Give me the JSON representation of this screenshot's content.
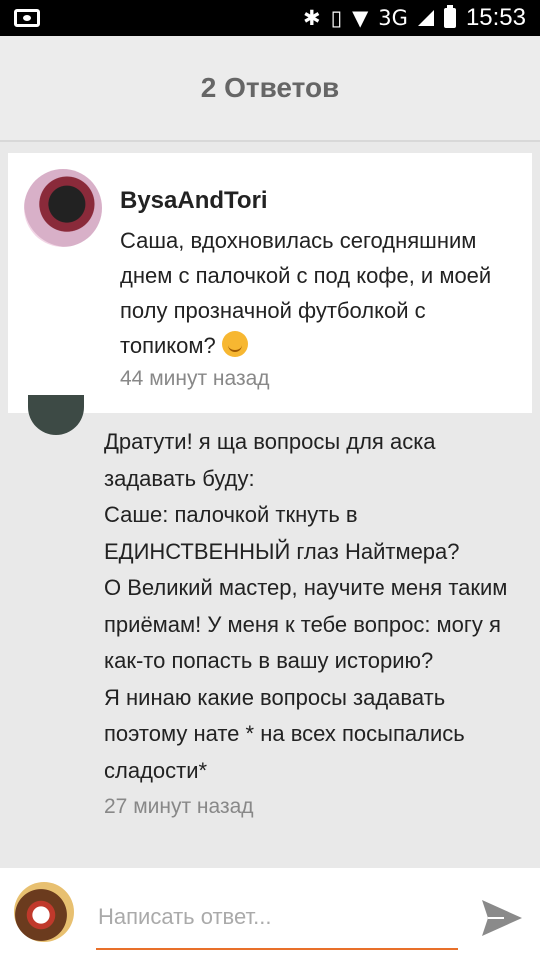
{
  "status_bar": {
    "network": "3G",
    "time": "15:53",
    "icons": [
      "camera-icon",
      "bluetooth-icon",
      "vibrate-icon",
      "wifi-icon",
      "signal-icon",
      "battery-icon"
    ]
  },
  "header": {
    "title": "2 Ответов"
  },
  "featured_comment": {
    "author": "BysaAndTori",
    "text": "Саша, вдохновилась сегодняшним днем с палочкой с под кофе, и моей полу прозначной футболкой с топиком?",
    "emoji": "smiling-face-icon",
    "time": "44 минут назад"
  },
  "reply": {
    "lines": [
      "Дратути! я ща вопросы для аска задавать буду:",
      "Саше: палочкой ткнуть в ЕДИНСТВЕННЫЙ глаз Найтмера?",
      "О Великий мастер, научите меня таким приёмам! У меня к тебе вопрос: могу я как-то попасть в вашу историю?",
      "Я нинаю какие вопросы задавать поэтому нате * на всех посыпались сладости*"
    ],
    "time": "27 минут назад"
  },
  "composer": {
    "placeholder": "Написать ответ...",
    "value": ""
  },
  "colors": {
    "accent": "#e8702a",
    "send": "#8a8a8a"
  }
}
